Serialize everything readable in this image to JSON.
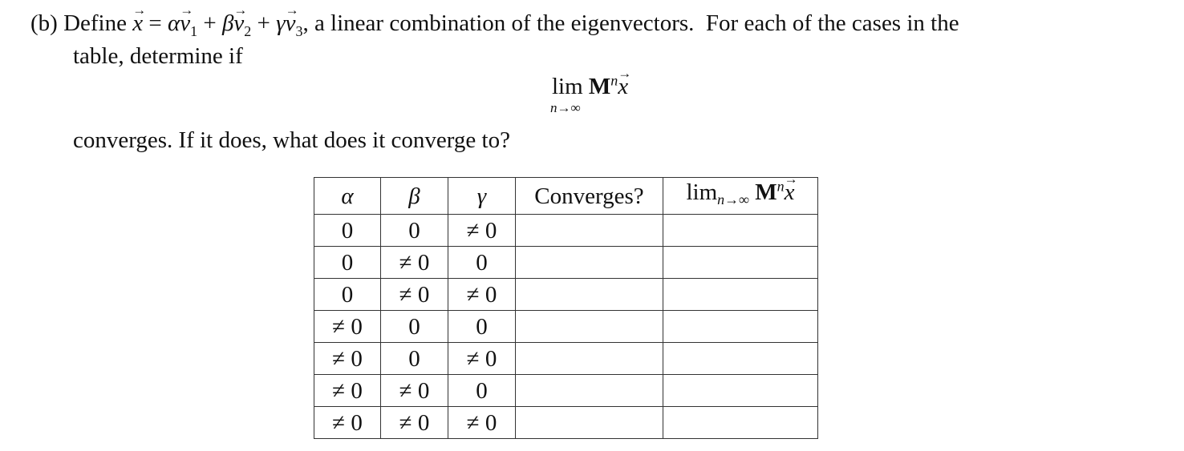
{
  "problem": {
    "part_label": "(b)",
    "line1_text_a": "Define",
    "line1_x": "x",
    "line1_eq": " = ",
    "line1_alpha": "α",
    "line1_v": "v",
    "line1_sub1": "1",
    "line1_plus1": " + ",
    "line1_beta": "β",
    "line1_sub2": "2",
    "line1_plus2": " + ",
    "line1_gamma": "γ",
    "line1_sub3": "3",
    "line1_text_b": ", a linear combination of the eigenvectors.  For each of the cases in the",
    "line2_text": "table, determine if",
    "display_lim": "lim",
    "display_M": "M",
    "display_n": "n",
    "display_x": "x",
    "display_under": "n→∞",
    "line3_text": "converges. If it does, what does it converge to?"
  },
  "table": {
    "headers": {
      "alpha": "α",
      "beta": "β",
      "gamma": "γ",
      "converges": "Converges?",
      "limit_lim": "lim",
      "limit_sub": "n→∞",
      "limit_M": "M",
      "limit_n": "n",
      "limit_x": "x"
    },
    "rows": [
      [
        "0",
        "0",
        "≠ 0",
        "",
        ""
      ],
      [
        "0",
        "≠ 0",
        "0",
        "",
        ""
      ],
      [
        "0",
        "≠ 0",
        "≠ 0",
        "",
        ""
      ],
      [
        "≠ 0",
        "0",
        "0",
        "",
        ""
      ],
      [
        "≠ 0",
        "0",
        "≠ 0",
        "",
        ""
      ],
      [
        "≠ 0",
        "≠ 0",
        "0",
        "",
        ""
      ],
      [
        "≠ 0",
        "≠ 0",
        "≠ 0",
        "",
        ""
      ]
    ]
  }
}
